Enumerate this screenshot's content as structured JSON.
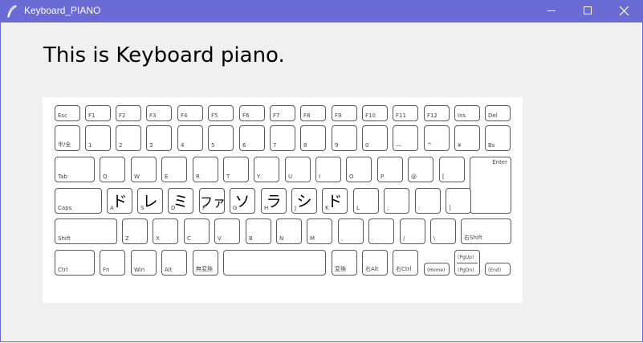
{
  "window": {
    "title": "Keyboard_PIANO"
  },
  "heading": "This is Keyboard piano.",
  "keys": {
    "esc": "Esc",
    "f1": "F1",
    "f2": "F2",
    "f3": "F3",
    "f4": "F4",
    "f5": "F5",
    "f6": "F6",
    "f7": "F7",
    "f8": "F8",
    "f9": "F9",
    "f10": "F10",
    "f11": "F11",
    "f12": "F12",
    "ins": "Ins",
    "del": "Del",
    "zenkaku": "半/全",
    "n1": "1",
    "n2": "2",
    "n3": "3",
    "n4": "4",
    "n5": "5",
    "n6": "6",
    "n7": "7",
    "n8": "8",
    "n9": "9",
    "n0": "0",
    "minus": "—",
    "caret": "^",
    "yen": "¥",
    "bs": "Bs",
    "tab": "Tab",
    "q": "Q",
    "w": "W",
    "e": "E",
    "r": "R",
    "t": "T",
    "y": "Y",
    "u": "U",
    "i": "I",
    "o": "O",
    "p": "P",
    "at": "@",
    "lbracket": "[",
    "enter": "Enter",
    "caps": "Caps",
    "a": "A",
    "s": "S",
    "d": "D",
    "f": "F",
    "g": "G",
    "h": "H",
    "j": "J",
    "k": "K",
    "l": "L",
    "semicolon": ";",
    "colon": ":",
    "rbracket": "]",
    "shift": "Shift",
    "z": "Z",
    "x": "X",
    "c": "C",
    "v": "V",
    "b": "B",
    "n": "N",
    "m": "M",
    "comma": ",",
    "period": ".",
    "slash": "/",
    "backslash": "\\",
    "rshift": "右Shift",
    "ctrl": "Ctrl",
    "fn": "Fn",
    "win": "Win",
    "alt": "Alt",
    "muhenkan": "無変換",
    "henkan": "変換",
    "ralt": "右Alt",
    "rctrl": "右Ctrl",
    "home": "(Home)",
    "pgup": "(PgUp)",
    "pgdn": "(PgDn)",
    "end": "(End)"
  },
  "notes": {
    "a": "ド",
    "s": "レ",
    "d": "ミ",
    "f": "ファ",
    "g": "ソ",
    "h": "ラ",
    "j": "シ",
    "k": "ド"
  }
}
